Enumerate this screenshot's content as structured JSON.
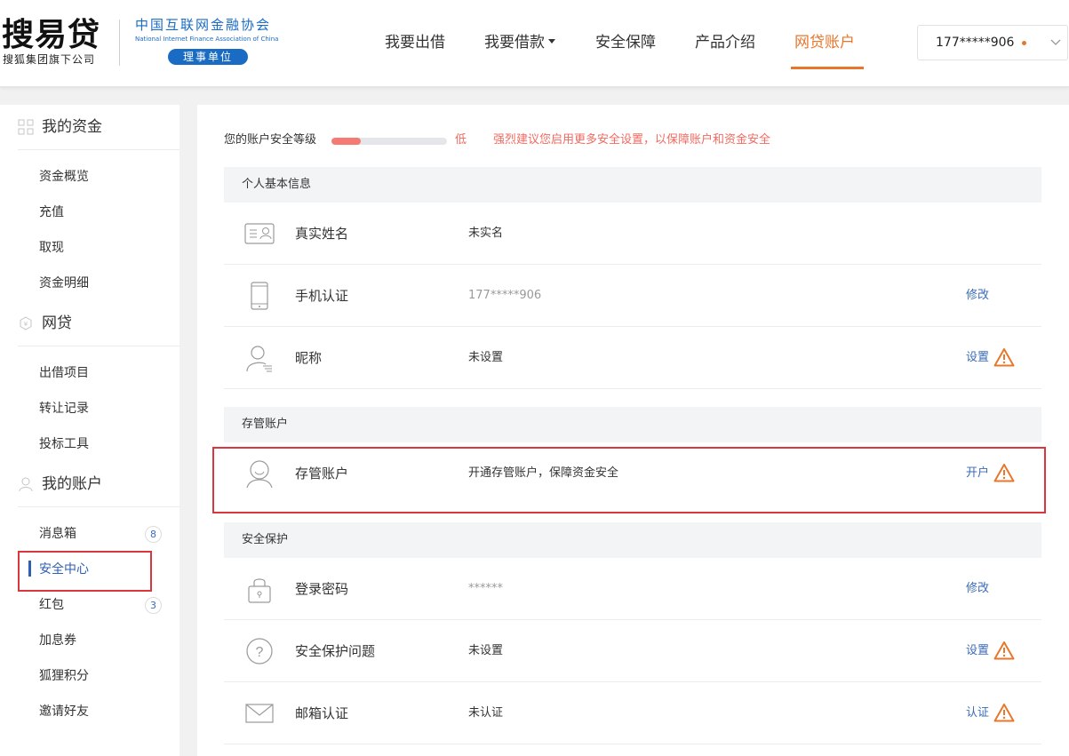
{
  "header": {
    "logo": "搜易贷",
    "logo_sub": "搜狐集团旗下公司",
    "assoc_cn": "中国互联网金融协会",
    "assoc_en": "National Internet Finance Association of China",
    "assoc_badge": "理事单位",
    "nav": [
      {
        "label": "我要出借"
      },
      {
        "label": "我要借款"
      },
      {
        "label": "安全保障"
      },
      {
        "label": "产品介绍"
      },
      {
        "label": "网贷账户",
        "active": true
      }
    ],
    "user_phone": "177*****906",
    "accent_color": "#e8772e"
  },
  "sidebar": {
    "groups": [
      {
        "title": "我的资金",
        "icon": "grid-icon",
        "items": [
          "资金概览",
          "充值",
          "取现",
          "资金明细"
        ]
      },
      {
        "title": "网贷",
        "icon": "hexagon-icon",
        "items": [
          "出借项目",
          "转让记录",
          "投标工具"
        ]
      },
      {
        "title": "我的账户",
        "icon": "user-icon",
        "items": [
          "消息箱",
          "安全中心",
          "红包",
          "加息券",
          "狐狸积分",
          "邀请好友"
        ]
      }
    ],
    "counts": {
      "inbox": "8",
      "red_packet": "3"
    },
    "active_item": "安全中心"
  },
  "security": {
    "level_label": "您的账户安全等级",
    "level_value": "低",
    "level_fraction": 0.25,
    "tip": "强烈建议您启用更多安全设置，以保障账户和资金安全",
    "warn_color": "#e8772e"
  },
  "sections": [
    {
      "title": "个人基本信息",
      "rows": [
        {
          "name": "真实姓名",
          "value": "未实名",
          "action": "",
          "icon": "id-card-icon"
        },
        {
          "name": "手机认证",
          "value": "177*****906",
          "action": "修改",
          "icon": "phone-icon"
        },
        {
          "name": "昵称",
          "value": "未设置",
          "action": "设置",
          "icon": "user-edit-icon",
          "warn": true
        }
      ]
    },
    {
      "title": "存管账户",
      "rows": [
        {
          "name": "存管账户",
          "value": "开通存管账户，保障资金安全",
          "action": "开户",
          "icon": "smile-user-icon",
          "warn": true
        }
      ]
    },
    {
      "title": "安全保护",
      "rows": [
        {
          "name": "登录密码",
          "value": "******",
          "action": "修改",
          "icon": "lock-icon"
        },
        {
          "name": "安全保护问题",
          "value": "未设置",
          "action": "设置",
          "icon": "question-icon",
          "warn": true
        },
        {
          "name": "邮箱认证",
          "value": "未认证",
          "action": "认证",
          "icon": "mail-icon",
          "warn": true
        }
      ]
    }
  ]
}
